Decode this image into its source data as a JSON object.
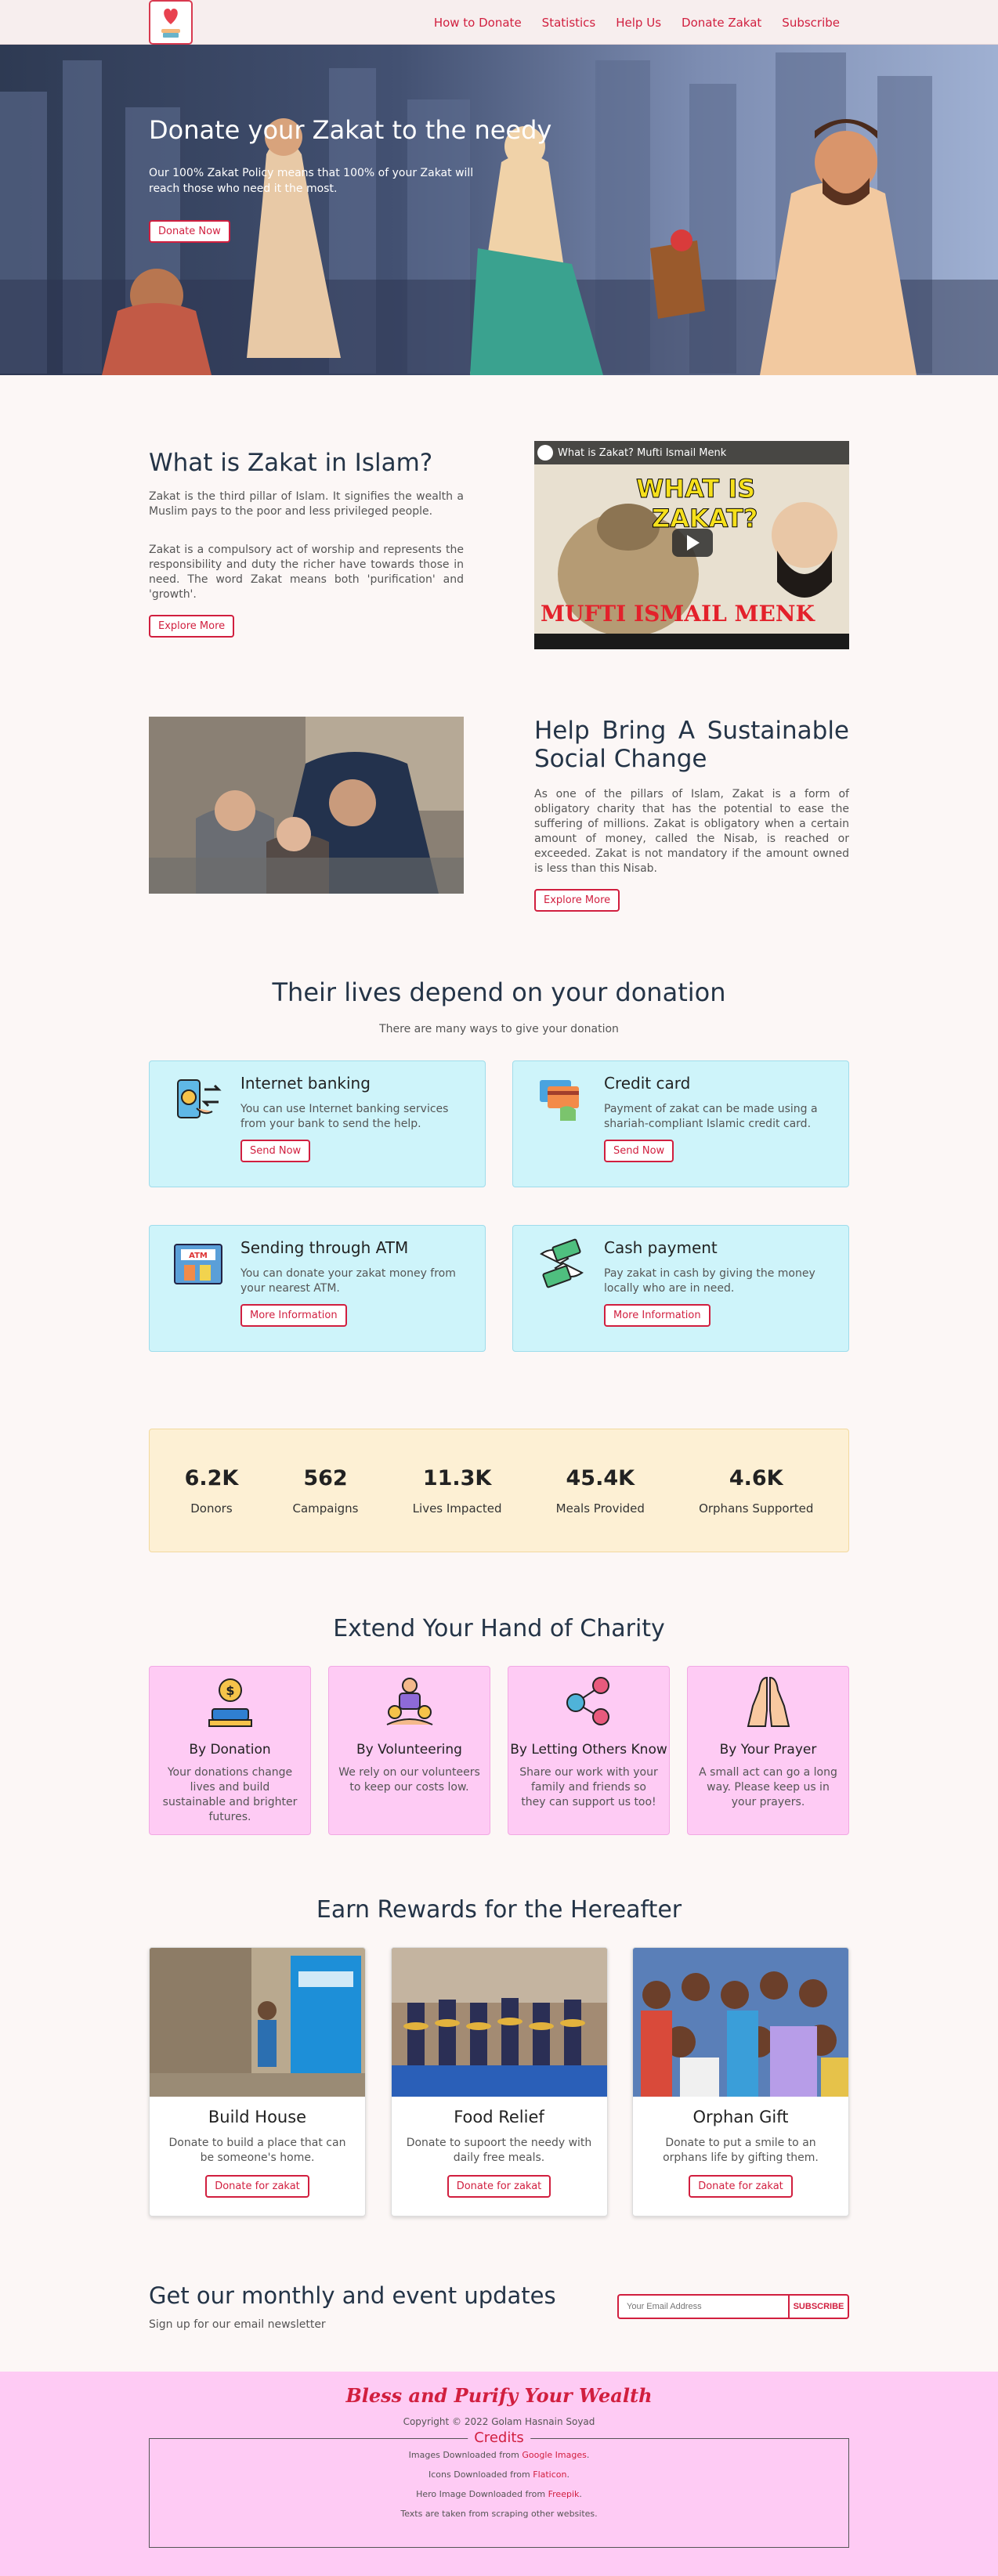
{
  "nav": {
    "logo_icon": "heart-in-hands-icon",
    "links": [
      "How to Donate",
      "Statistics",
      "Help Us",
      "Donate Zakat",
      "Subscribe"
    ]
  },
  "hero": {
    "title": "Donate your Zakat to the needy",
    "text": "Our 100% Zakat Policy means that 100% of your Zakat will reach those who need it the most.",
    "button": "Donate Now"
  },
  "about": {
    "title": "What is Zakat in Islam?",
    "p1": "Zakat is the third pillar of Islam. It signifies the wealth a Muslim pays to the poor and less privileged people.",
    "p2": "Zakat is a compulsory act of worship and represents the responsibility and duty the richer have towards those in need. The word Zakat means both 'purification' and 'growth'.",
    "button": "Explore More",
    "video": {
      "title": "What is Zakat? Mufti Ismail Menk",
      "overlay_top": "WHAT IS",
      "overlay_mid": "ZAKAT?",
      "overlay_bottom": "MUFTI ISMAIL MENK"
    }
  },
  "change": {
    "title": "Help Bring A Sustainable Social Change",
    "text": "As one of the pillars of Islam, Zakat is a form of obligatory charity that has the potential to ease the suffering of millions. Zakat is obligatory when a certain amount of money, called the Nisab, is reached or exceeded. Zakat is not mandatory if the amount owned is less than this Nisab.",
    "button": "Explore More"
  },
  "ways": {
    "title": "Their lives depend on your donation",
    "subtitle": "There are many ways to give your donation",
    "items": [
      {
        "icon": "mobile-transfer-icon",
        "title": "Internet banking",
        "text": "You can use Internet banking services from your bank to send the help.",
        "button": "Send Now"
      },
      {
        "icon": "credit-card-icon",
        "title": "Credit card",
        "text": "Payment of zakat can be made using a shariah-compliant Islamic credit card.",
        "button": "Send Now"
      },
      {
        "icon": "atm-icon",
        "title": "Sending through ATM",
        "text": "You can donate your zakat money from your nearest ATM.",
        "button": "More Information"
      },
      {
        "icon": "cash-hand-icon",
        "title": "Cash payment",
        "text": "Pay zakat in cash by giving the money locally who are in need.",
        "button": "More Information"
      }
    ]
  },
  "stats": [
    {
      "value": "6.2K",
      "label": "Donors"
    },
    {
      "value": "562",
      "label": "Campaigns"
    },
    {
      "value": "11.3K",
      "label": "Lives Impacted"
    },
    {
      "value": "45.4K",
      "label": "Meals Provided"
    },
    {
      "value": "4.6K",
      "label": "Orphans Supported"
    }
  ],
  "extend": {
    "title": "Extend Your Hand of Charity",
    "items": [
      {
        "icon": "coin-donation-icon",
        "title": "By Donation",
        "text": "Your donations change lives and build sustainable and brighter futures."
      },
      {
        "icon": "volunteer-icon",
        "title": "By Volunteering",
        "text": "We rely on our volunteers to keep our costs low."
      },
      {
        "icon": "network-people-icon",
        "title": "By Letting Others Know",
        "text": "Share our work with your family and friends so they can support us too!"
      },
      {
        "icon": "praying-hands-icon",
        "title": "By Your Prayer",
        "text": "A small act can go a long way. Please keep us in your prayers."
      }
    ]
  },
  "rewards": {
    "title": "Earn Rewards for the Hereafter",
    "items": [
      {
        "title": "Build House",
        "text": "Donate to build a place that can be someone's home.",
        "button": "Donate for zakat"
      },
      {
        "title": "Food Relief",
        "text": "Donate to supoort the needy with daily free meals.",
        "button": "Donate for zakat"
      },
      {
        "title": "Orphan Gift",
        "text": "Donate to put a smile to an orphans life by gifting them.",
        "button": "Donate for zakat"
      }
    ]
  },
  "newsletter": {
    "title": "Get our monthly and event updates",
    "subtitle": "Sign up for our email newsletter",
    "placeholder": "Your Email Address",
    "button": "SUBSCRIBE"
  },
  "footer": {
    "brand": "Bless and Purify Your Wealth",
    "copyright": "Copyright © 2022 Golam Hasnain Soyad",
    "credits_title": "Credits",
    "c1_pre": "Images Downloaded from ",
    "c1_link": "Google Images",
    "c2_pre": "Icons Downloaded from ",
    "c2_link": "Flaticon",
    "c3_pre": "Hero Image Downloaded from ",
    "c3_link": "Freepik",
    "c4": "Texts are taken from scraping other websites."
  }
}
